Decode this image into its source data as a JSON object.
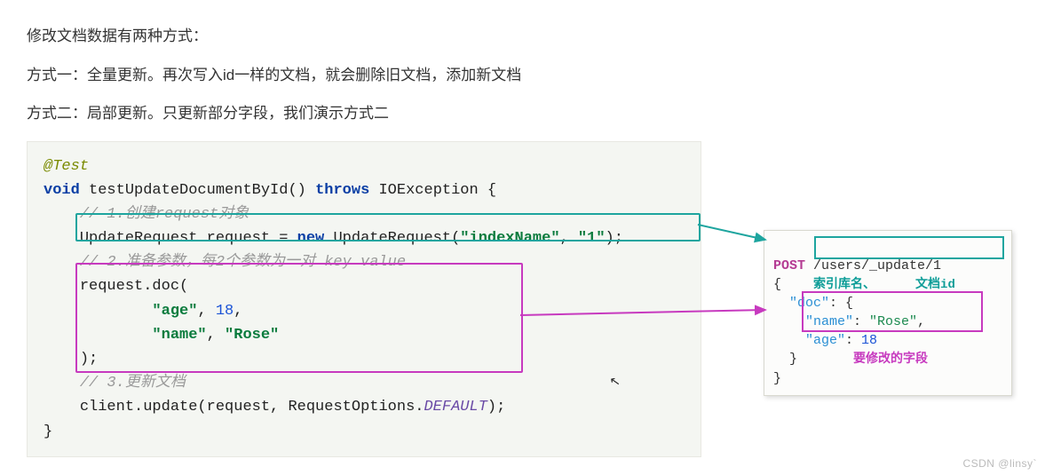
{
  "intro": {
    "line1": "修改文档数据有两种方式：",
    "line2": "方式一：全量更新。再次写入id一样的文档，就会删除旧文档，添加新文档",
    "line3": "方式二：局部更新。只更新部分字段，我们演示方式二"
  },
  "code": {
    "anno": "@Test",
    "kw_void": "void",
    "method": "testUpdateDocumentById()",
    "kw_throws": "throws",
    "exc": "IOException",
    "brace_open": "{",
    "c1": "// 1.创建request对象",
    "line_req_1": "UpdateRequest request = ",
    "kw_new": "new",
    "line_req_2": " UpdateRequest(",
    "s_index": "\"indexName\"",
    "comma": ", ",
    "s_id": "\"1\"",
    "paren_end": ");",
    "c2": "// 2.准备参数，每2个参数为一对 key value",
    "doc_open": "request.doc(",
    "s_age": "\"age\"",
    "n_18": "18",
    "s_name": "\"name\"",
    "s_rose": "\"Rose\"",
    "doc_close": ");",
    "c3": "// 3.更新文档",
    "upd_1": "client.update(request, RequestOptions.",
    "upd_def": "DEFAULT",
    "upd_2": ");",
    "brace_close": "}"
  },
  "json": {
    "post": "POST",
    "path": "/users/_update/1",
    "brace_open": "{",
    "doc_key": "\"doc\"",
    "colon_brace": ": {",
    "name_key": "\"name\"",
    "name_val": "\"Rose\"",
    "age_key": "\"age\"",
    "age_val": "18",
    "inner_close": "}",
    "outer_close": "}",
    "label_index": "索引库名、",
    "label_docid": "文档id",
    "label_fields": "要修改的字段"
  },
  "watermark": "CSDN @linsy`"
}
